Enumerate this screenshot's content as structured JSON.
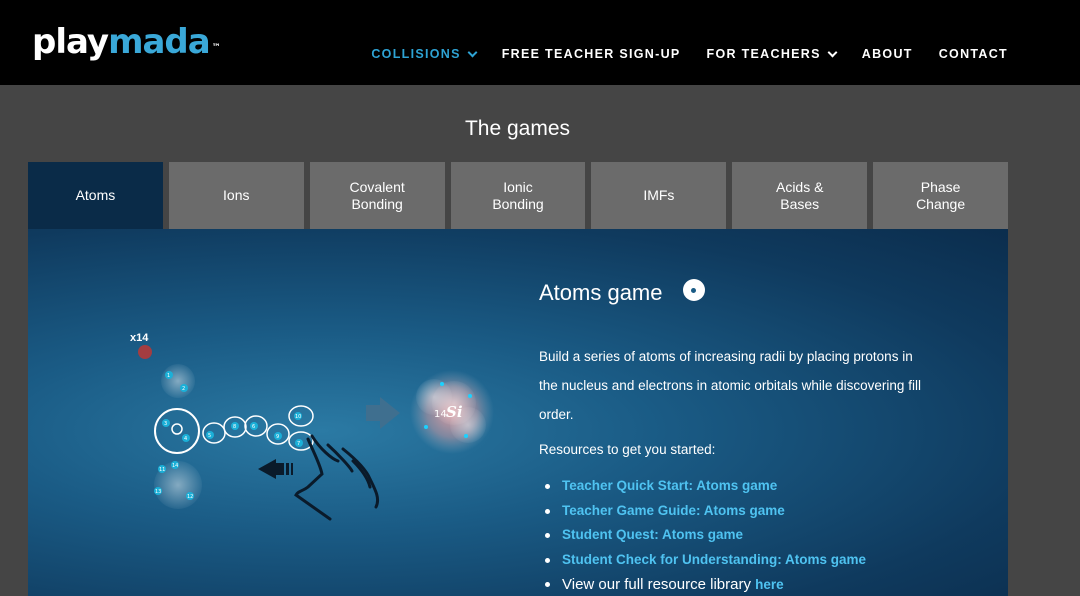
{
  "header": {
    "logo": {
      "part1": "play",
      "part2": "mada",
      "tm": "™"
    },
    "nav": [
      {
        "label": "COLLISIONS",
        "has_dropdown": true,
        "active": true
      },
      {
        "label": "FREE TEACHER SIGN-UP",
        "has_dropdown": false
      },
      {
        "label": "FOR TEACHERS",
        "has_dropdown": true
      },
      {
        "label": "ABOUT",
        "has_dropdown": false
      },
      {
        "label": "CONTACT",
        "has_dropdown": false
      }
    ]
  },
  "section_title": "The games",
  "tabs": [
    {
      "label": "Atoms",
      "active": true
    },
    {
      "label": "Ions"
    },
    {
      "label": "Covalent\nBonding"
    },
    {
      "label": "Ionic\nBonding"
    },
    {
      "label": "IMFs"
    },
    {
      "label": "Acids &\nBases"
    },
    {
      "label": "Phase\nChange"
    }
  ],
  "panel": {
    "title": "Atoms game",
    "info_icon": "info-icon",
    "description": "Build a series of atoms of increasing radii by placing protons in the nucleus and electrons in atomic orbitals while discovering fill order.",
    "resources_label": "Resources to get you started:",
    "resources": [
      {
        "prefix": "Teacher Quick Start:  ",
        "link": "Atoms game"
      },
      {
        "prefix": "Teacher Game Guide:  ",
        "link": "Atoms game"
      },
      {
        "prefix": "Student Quest:  ",
        "link": "Atoms game"
      },
      {
        "prefix": "Student Check for Understanding:  ",
        "link": "Atoms game"
      }
    ],
    "library": {
      "text": "View our full resource library ",
      "link": "here"
    },
    "illustration": {
      "multiplier": "x14",
      "element_mass": "14",
      "element_symbol": "Si",
      "orbital_numbers": [
        "1",
        "2",
        "3",
        "4",
        "5",
        "6",
        "7",
        "8",
        "9",
        "10",
        "11",
        "12",
        "13",
        "14"
      ]
    }
  },
  "colors": {
    "accent": "#2ea3d4",
    "link": "#4fc3f1",
    "topbar": "#000000",
    "active_tab": "#0a2b48",
    "tab": "#6b6b6b",
    "page_bg": "#454545"
  }
}
